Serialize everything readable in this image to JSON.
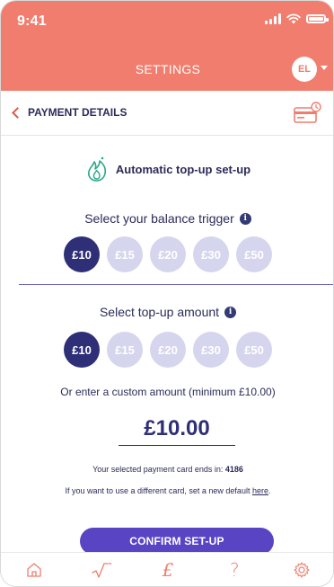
{
  "status_bar": {
    "time": "9:41"
  },
  "header": {
    "title": "SETTINGS",
    "avatar_initials": "EL"
  },
  "subheader": {
    "back_label": "PAYMENT DETAILS"
  },
  "auto_topup": {
    "heading": "Automatic top-up set-up"
  },
  "balance_trigger": {
    "label": "Select your balance trigger",
    "options": [
      "£10",
      "£15",
      "£20",
      "£30",
      "£50"
    ],
    "selected": "£10"
  },
  "topup_amount": {
    "label": "Select top-up amount",
    "options": [
      "£10",
      "£15",
      "£20",
      "£30",
      "£50"
    ],
    "selected": "£10"
  },
  "custom_amount": {
    "label": "Or enter a custom amount (minimum £10.00)",
    "value": "£10.00"
  },
  "card_info": {
    "prefix": "Your selected payment card ends in:",
    "last_four": "4186",
    "different_prefix": "If you want to use a different card, set a new default",
    "here_link": "here",
    "different_suffix": "."
  },
  "confirm_button": {
    "label": "CONFIRM SET-UP"
  },
  "info_glyph": "i",
  "bottom_nav": {
    "pound_symbol": "£",
    "question_symbol": "?"
  },
  "colors": {
    "header": "#f07d6d",
    "primary": "#2e2f77",
    "chip_inactive": "#d6d5ee",
    "button": "#5944c4"
  }
}
